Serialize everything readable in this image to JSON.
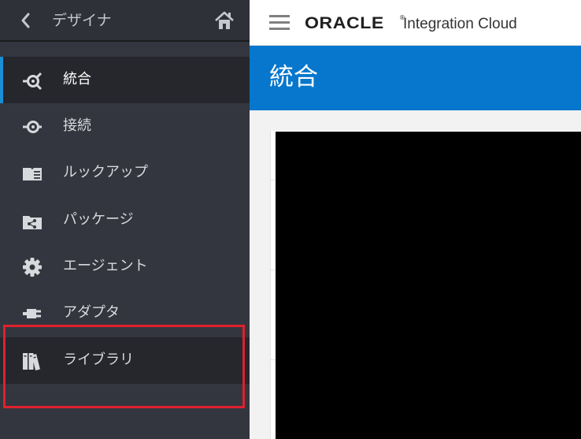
{
  "sidebar": {
    "title": "デザイナ",
    "back_icon": "chevron-left-icon",
    "home_icon": "home-icon",
    "items": [
      {
        "label": "統合",
        "icon": "integration-icon",
        "active": true
      },
      {
        "label": "接続",
        "icon": "connection-icon",
        "active": false
      },
      {
        "label": "ルックアップ",
        "icon": "lookup-icon",
        "active": false
      },
      {
        "label": "パッケージ",
        "icon": "package-icon",
        "active": false
      },
      {
        "label": "エージェント",
        "icon": "gear-icon",
        "active": false
      },
      {
        "label": "アダプタ",
        "icon": "adapter-plug-icon",
        "active": false
      },
      {
        "label": "ライブラリ",
        "icon": "library-books-icon",
        "active": false,
        "highlighted": true
      }
    ]
  },
  "topbar": {
    "menu_icon": "hamburger-menu-icon",
    "brand": "ORACLE",
    "registered": "®",
    "product": "Integration Cloud"
  },
  "page": {
    "title": "統合"
  },
  "colors": {
    "sidebar_bg": "#34363f",
    "active_item_bg": "#25272c",
    "active_indicator": "#1b8fd6",
    "title_band": "#0677cc",
    "highlight_border": "#e0202e"
  }
}
